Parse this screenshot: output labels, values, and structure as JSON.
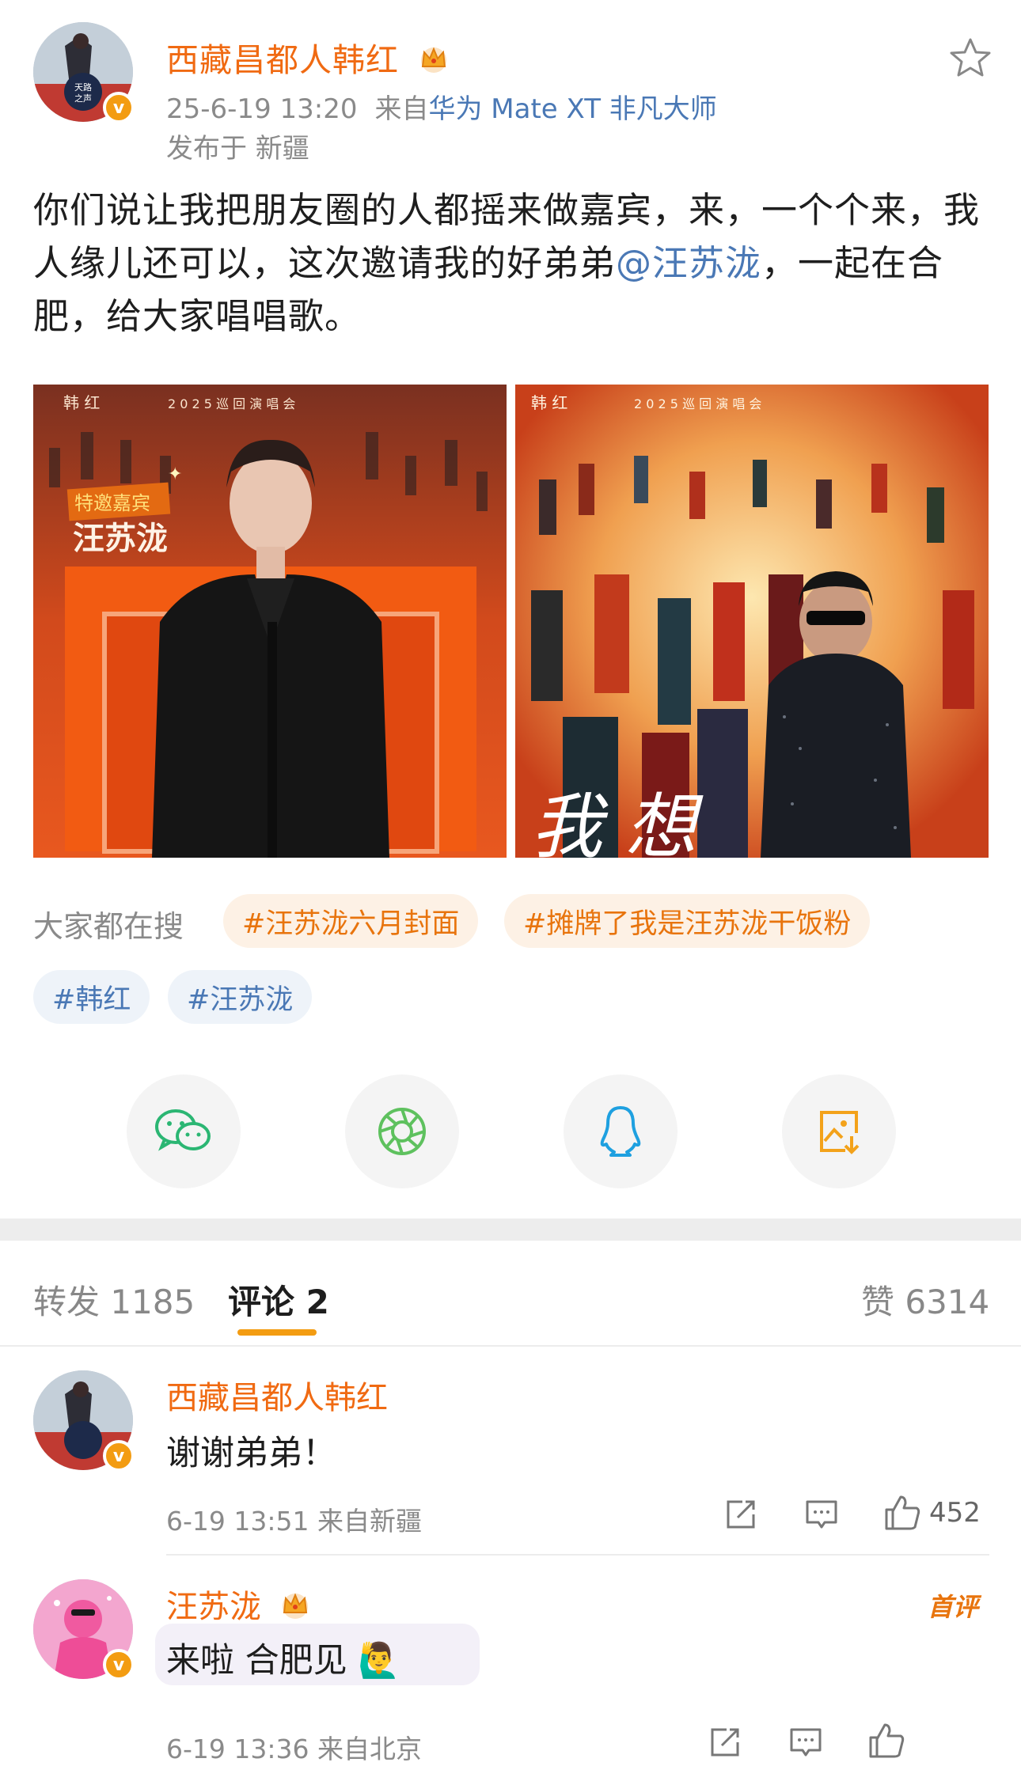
{
  "post": {
    "author": "西藏昌都人韩红",
    "timestamp": "25-6-19 13:20",
    "source_prefix": "来自",
    "device": "华为 Mate XT 非凡大师",
    "location": "发布于 新疆",
    "text_before_mention": "你们说让我把朋友圈的人都摇来做嘉宾，来，一个个来，我人缘儿还可以，这次邀请我的好弟弟",
    "mention": "@汪苏泷",
    "text_after_mention": "，一起在合肥，给大家唱唱歌。",
    "poster_left": {
      "header_name": "韩 红",
      "header_tour": "2 0 2 5 巡 回 演 唱 会",
      "guest_label": "特邀嘉宾",
      "guest_name": "汪苏泷"
    },
    "poster_right": {
      "header_name": "韩 红",
      "header_tour": "2 0 2 5 巡 回 演 唱 会",
      "calligraphy": "我 想"
    }
  },
  "search": {
    "label": "大家都在搜",
    "hot_tags": [
      "#汪苏泷六月封面",
      "#摊牌了我是汪苏泷干饭粉"
    ],
    "topic_tags": [
      "#韩红",
      "#汪苏泷"
    ]
  },
  "share": {
    "icons": [
      "wechat-icon",
      "moments-icon",
      "qq-icon",
      "save-image-icon"
    ],
    "colors": {
      "wechat": "#2bb673",
      "moments": "#5ec15e",
      "qq": "#1ea0e0",
      "save": "#f3a21a"
    }
  },
  "tabs": {
    "repost_label": "转发 1185",
    "comment_label": "评论 2",
    "like_label": "赞 6314"
  },
  "comments": [
    {
      "author": "西藏昌都人韩红",
      "text": "谢谢弟弟！",
      "meta": "6-19 13:51  来自新疆",
      "likes": "452"
    },
    {
      "author": "汪苏泷",
      "badge": "首评",
      "text": "来啦 合肥见",
      "emoji": "🙋‍♂️",
      "meta": "6-19 13:36  来自北京"
    }
  ],
  "accent": "#f06a12",
  "link_color": "#4a78b5"
}
